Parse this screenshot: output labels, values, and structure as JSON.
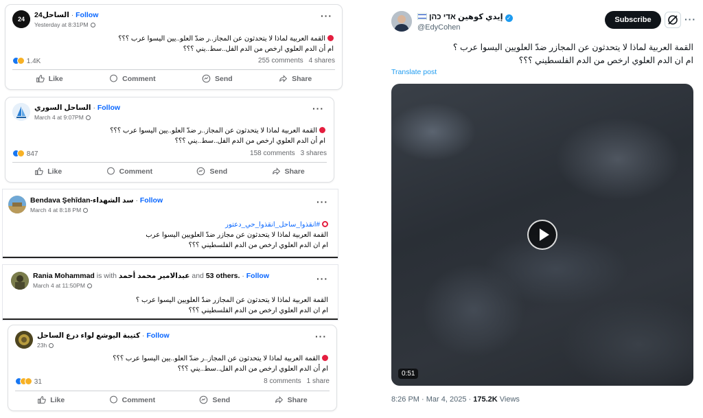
{
  "posts": [
    {
      "name": "الساحل24",
      "follow": "Follow",
      "time": "Yesterday at 8:31PM",
      "line1": "القمة العربية لماذا لا يتحدثون عن المجاز..ر ضدّ العلو..يين اليسوا عرب ؟؟؟",
      "line2": "ام أن الدم العلوي ارخص من الدم الفل..سط..يني ؟؟؟",
      "reactions": "1.4K",
      "comments": "255 comments",
      "shares": "4 shares",
      "actions": [
        "Like",
        "Comment",
        "Send",
        "Share"
      ]
    },
    {
      "name": "الساحل السوري",
      "follow": "Follow",
      "time": "March 4 at 9:07PM",
      "line1": "القمة العربية لماذا لا يتحدثون عن المجاز..ر ضدّ العلو..يين اليسوا عرب ؟؟؟",
      "line2": "ام أن الدم العلوي ارخص من الدم الفل..سط..يني ؟؟؟",
      "reactions": "847",
      "comments": "158 comments",
      "shares": "3 shares",
      "actions": [
        "Like",
        "Comment",
        "Send",
        "Share"
      ]
    },
    {
      "name": "Bendava Şehîdan-سد الشهداء",
      "follow": "Follow",
      "time": "March 4 at 8:18 PM",
      "hashtag": "#انقذوا_ساحل_انقذوا_حي_دعتور",
      "line1": "القمة العربية لماذا لا يتحدثون عن مجازر ضدّ العلويين اليسوا عرب",
      "line2": "ام ان الدم العلوي ارخص من الدم الفلسطيني ؟؟؟"
    },
    {
      "name": "Rania Mohammad",
      "with": "is with",
      "tagged": "عبدالامير محمد أحمد",
      "and": "and",
      "others": "53 others.",
      "follow": "Follow",
      "time": "March 4 at 11:50PM",
      "line1": "القمة العربية لماذا لا يتحدثون عن المجازر ضدّ العلويين اليسوا عرب ؟",
      "line2": "ام ان الدم العلوي ارخص من الدم الفلسطيني ؟؟؟"
    },
    {
      "name": "كتيبة اليوشع لواء درع الساحل",
      "follow": "Follow",
      "time": "23h",
      "line1": "القمة العربية لماذا لا يتحدثون عن المجاز..ر ضدّ العلو..يين اليسوا عرب ؟؟؟",
      "line2": "ام أن الدم العلوي ارخص من الدم الفل..سط..يني ؟؟؟",
      "reactions": "31",
      "comments": "8 comments",
      "shares": "1 share",
      "actions": [
        "Like",
        "Comment",
        "Send",
        "Share"
      ]
    }
  ],
  "x_post": {
    "name": "إيدي كوهين אדי כהן",
    "handle": "@EdyCohen",
    "subscribe": "Subscribe",
    "line1": "القمة العربية لماذا لا يتحدثون عن المجازر ضدّ العلويين اليسوا عرب ؟",
    "line2": "ام ان الدم العلوي ارخص من الدم الفلسطيني ؟؟؟",
    "translate": "Translate post",
    "duration": "0:51",
    "timestamp": "8:26 PM · Mar 4, 2025 · ",
    "views_count": "175.2K",
    "views_label": " Views"
  }
}
